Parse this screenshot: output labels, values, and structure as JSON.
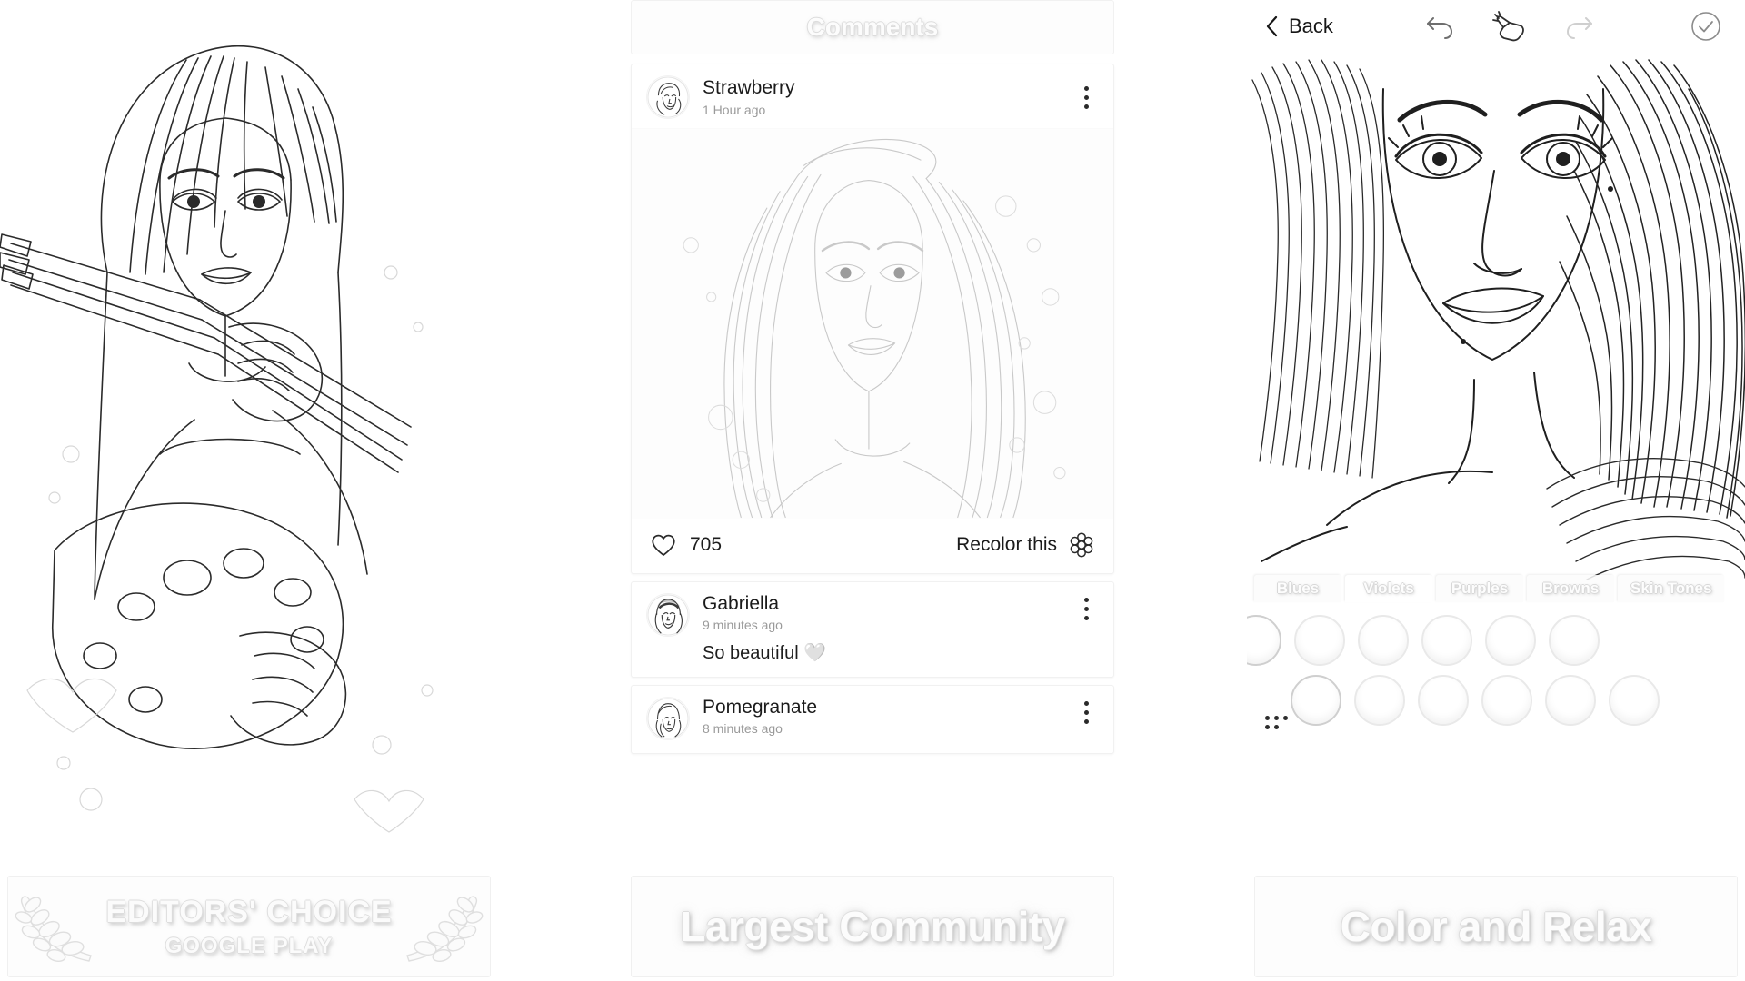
{
  "panels": [
    {
      "id": "panel-hero",
      "caption": "EDITORS' CHOICE",
      "caption_sub": "GOOGLE PLAY",
      "artwork_alt": "line-art girl holding paint brushes and palette"
    },
    {
      "id": "panel-comments",
      "header_title": "Comments",
      "caption": "Largest Community",
      "post": {
        "author": "Strawberry",
        "time": "1 Hour ago",
        "menu_icon": "kebab-menu-icon",
        "image_alt": "line-art portrait of a long haired woman",
        "like_icon": "heart-icon",
        "likes": "705",
        "recolor_label": "Recolor this",
        "recolor_icon": "flower-icon"
      },
      "comments": [
        {
          "author": "Gabriella",
          "time": "9 minutes ago",
          "text": "So beautiful 🤍",
          "menu_icon": "kebab-menu-icon"
        },
        {
          "author": "Pomegranate",
          "time": "8 minutes ago",
          "text": "",
          "menu_icon": "kebab-menu-icon"
        }
      ]
    },
    {
      "id": "panel-editor",
      "caption": "Color and Relax",
      "toolbar": {
        "back_label": "Back",
        "back_icon": "chevron-left-icon",
        "undo_icon": "undo-arrow-icon",
        "tool_icon": "hand-pointer-icon",
        "redo_icon": "redo-arrow-icon",
        "done_icon": "check-circle-icon"
      },
      "palette_tabs": [
        {
          "label": "Blues",
          "active": false
        },
        {
          "label": "Violets",
          "active": true
        },
        {
          "label": "Purples",
          "active": false
        },
        {
          "label": "Browns",
          "active": false
        },
        {
          "label": "Skin Tones",
          "active": false
        }
      ],
      "swatch_rows": [
        {
          "count": 5
        },
        {
          "count": 6
        }
      ],
      "canvas_alt": "line-art close-up portrait of a woman with flowing hair"
    }
  ],
  "colors": {
    "text_primary": "#1b1b1b",
    "text_muted": "#9a9a9a",
    "panel_bg": "#ffffff",
    "card_border": "#f1f1f1",
    "caption_text": "#fcfcfc",
    "caption_outline": "#dddddd"
  }
}
